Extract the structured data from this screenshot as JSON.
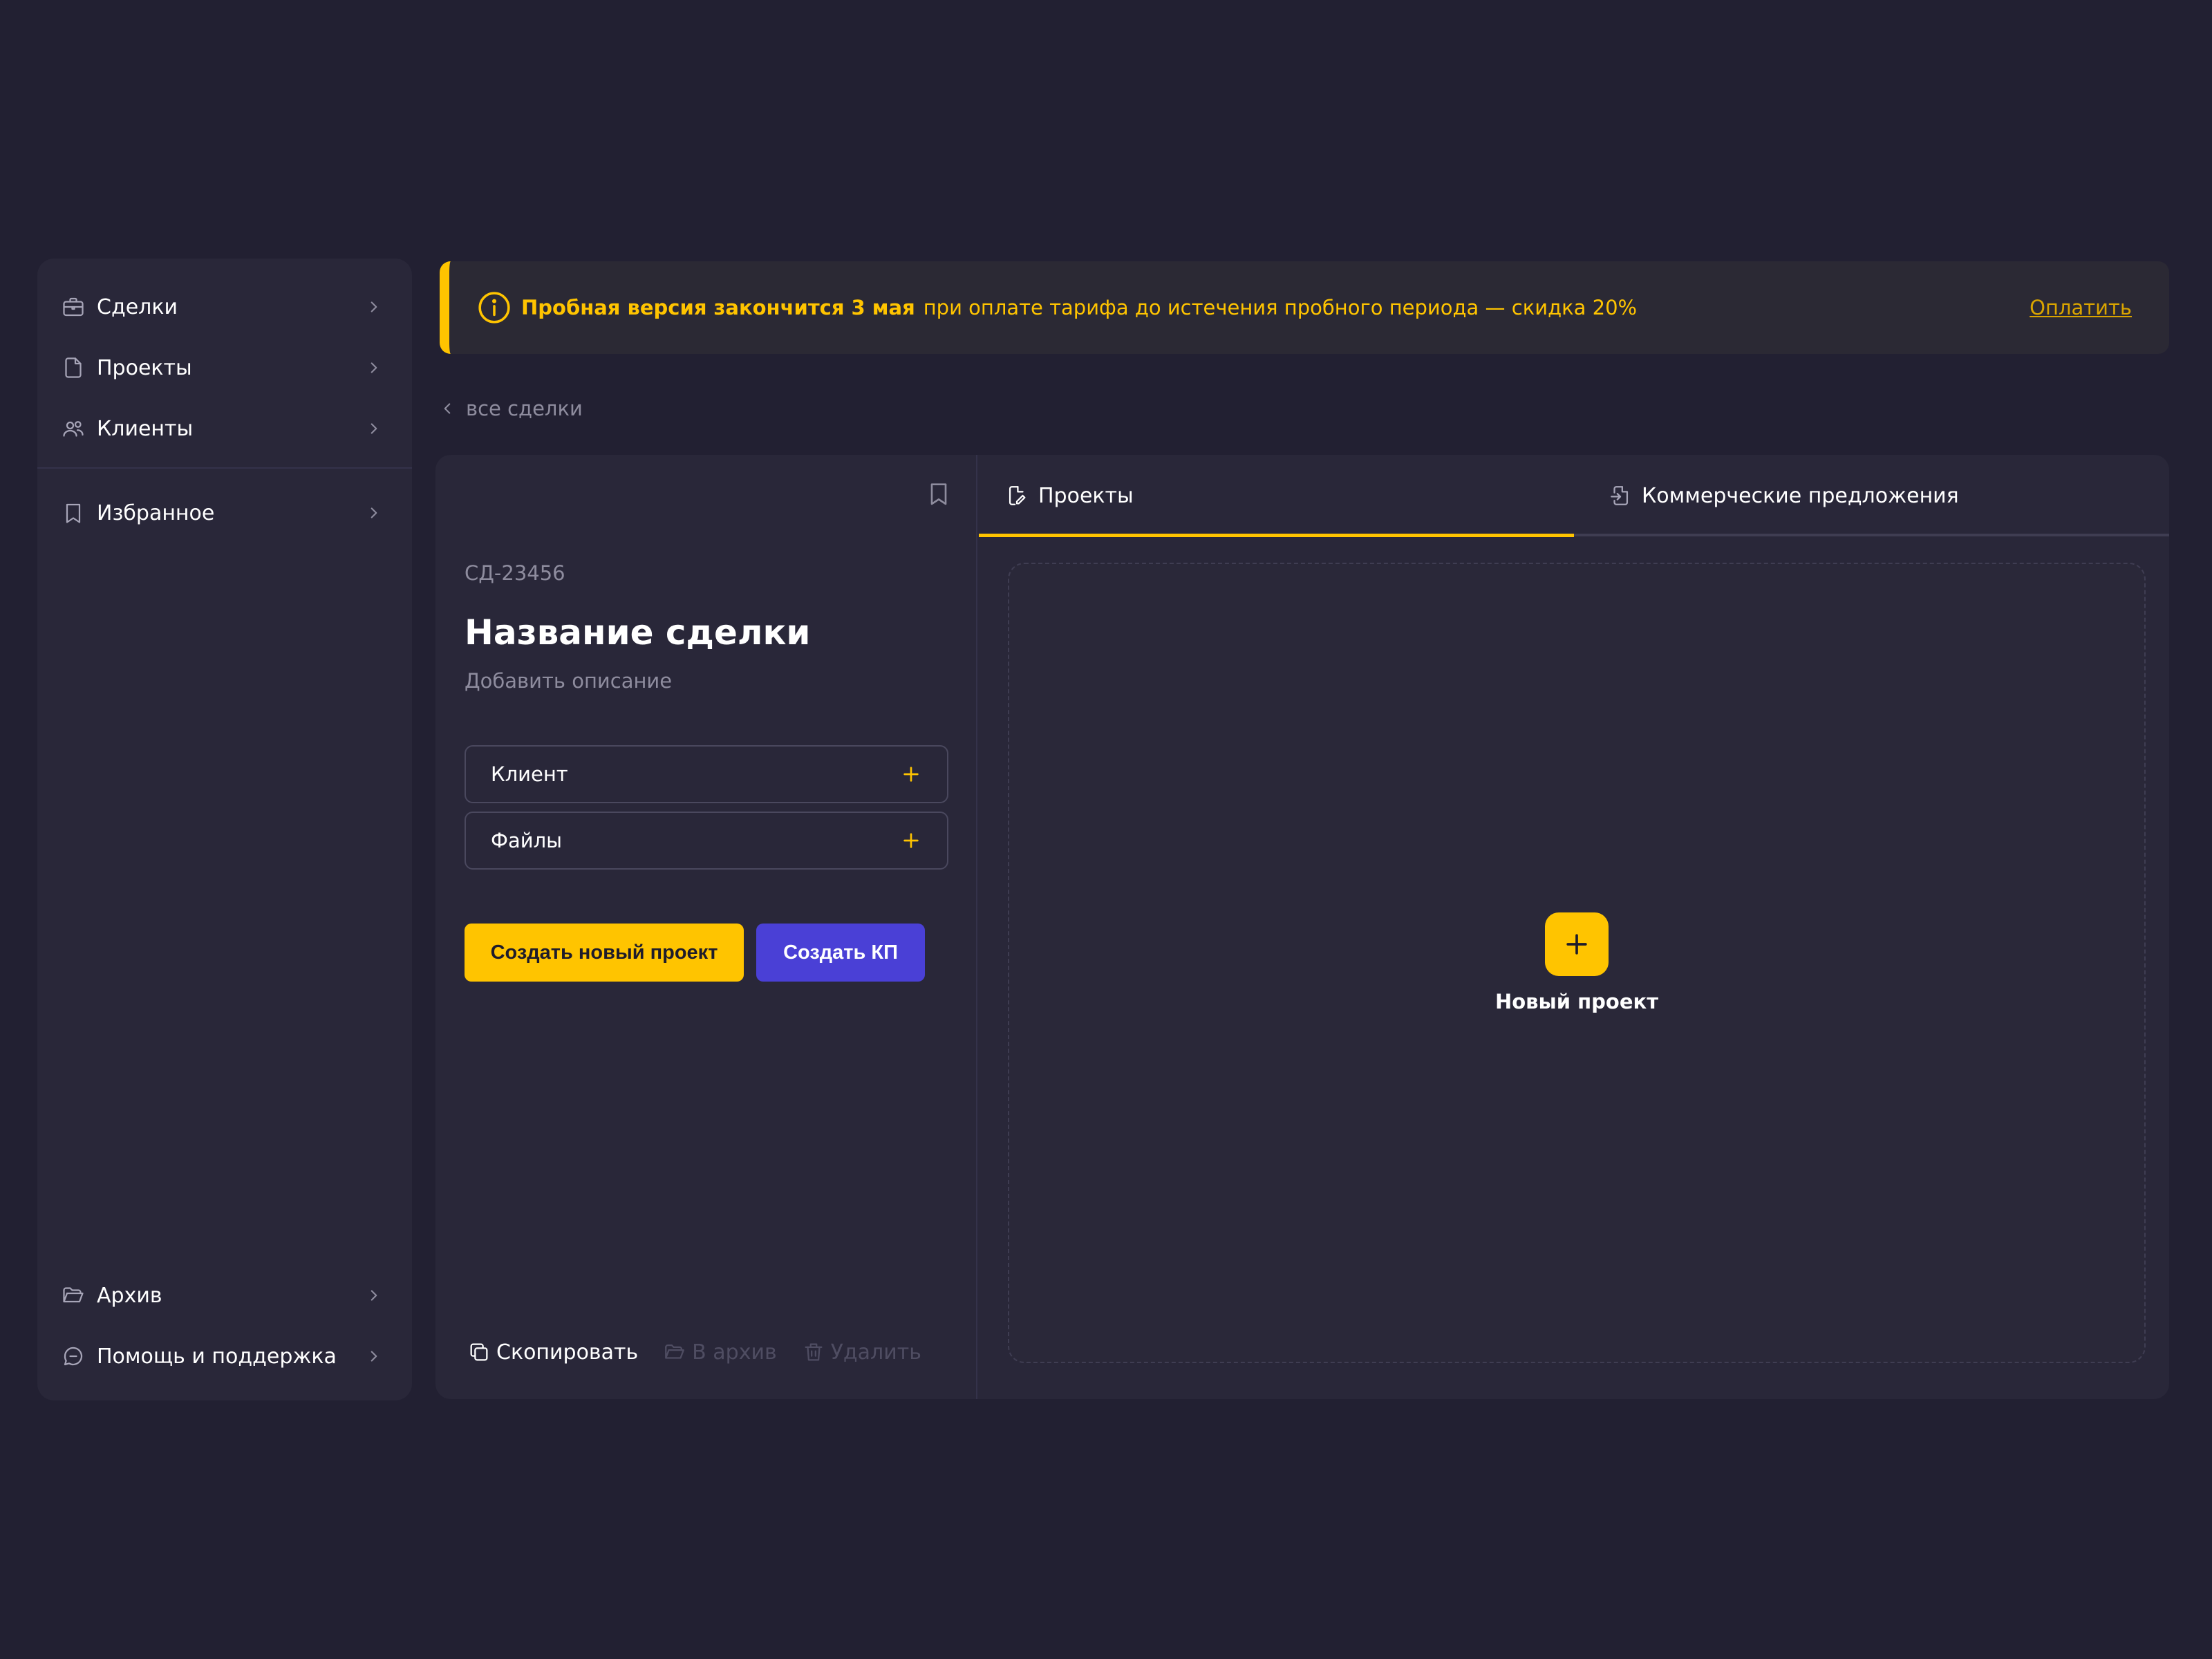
{
  "colors": {
    "background": "#222032",
    "panel": "#292739",
    "accent": "#FFC400",
    "primary_button": "#4A40D6",
    "muted_text": "#8E8C9E",
    "disabled_text": "#4F4D62"
  },
  "sidebar": {
    "top_items": [
      {
        "label": "Сделки",
        "icon": "briefcase-icon"
      },
      {
        "label": "Проекты",
        "icon": "document-icon"
      },
      {
        "label": "Клиенты",
        "icon": "users-icon"
      }
    ],
    "favorites": {
      "label": "Избранное",
      "icon": "bookmark-icon"
    },
    "bottom_items": [
      {
        "label": "Архив",
        "icon": "folder-open-icon"
      },
      {
        "label": "Помощь и поддержка",
        "icon": "support-chat-icon"
      }
    ]
  },
  "banner": {
    "strong": "Пробная версия закончится 3 мая",
    "message": "при оплате тарифа до истечения пробного периода — скидка 20%",
    "action": "Оплатить"
  },
  "breadcrumb": {
    "back_label": "все сделки"
  },
  "deal": {
    "id": "СД-23456",
    "title": "Название сделки",
    "description_placeholder": "Добавить описание",
    "fields": [
      {
        "label": "Клиент"
      },
      {
        "label": "Файлы"
      }
    ],
    "buttons": {
      "create_project": "Создать новый проект",
      "create_offer": "Создать КП"
    },
    "actions": {
      "copy": "Скопировать",
      "archive": "В архив",
      "delete": "Удалить"
    }
  },
  "tabs": [
    {
      "label": "Проекты",
      "icon": "edit-document-icon",
      "active": true
    },
    {
      "label": "Коммерческие предложения",
      "icon": "document-import-icon",
      "active": false
    }
  ],
  "dropzone": {
    "new_project_label": "Новый проект"
  }
}
